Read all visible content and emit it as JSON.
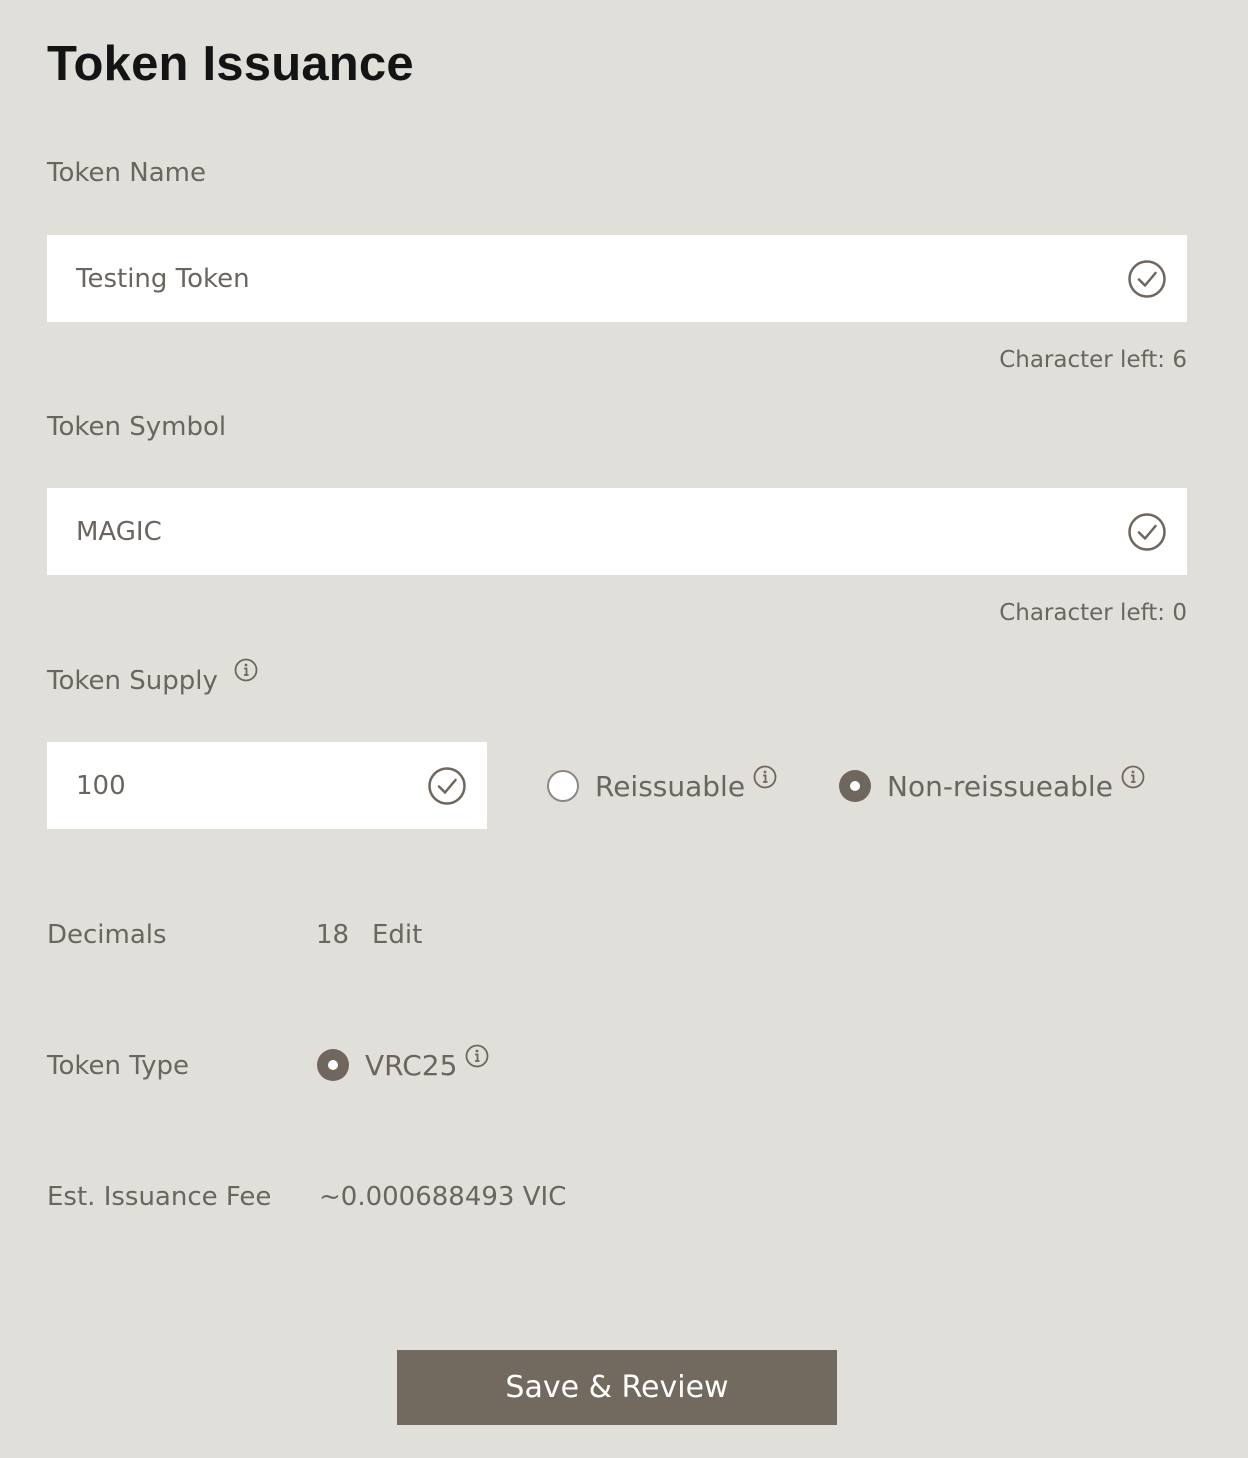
{
  "page": {
    "title": "Token Issuance"
  },
  "token_name": {
    "label": "Token Name",
    "value": "Testing Token",
    "char_left": "Character left: 6"
  },
  "token_symbol": {
    "label": "Token Symbol",
    "value": "MAGIC",
    "char_left": "Character left: 0"
  },
  "token_supply": {
    "label": "Token Supply",
    "value": "100",
    "options": [
      {
        "label": "Reissuable",
        "selected": false
      },
      {
        "label": "Non-reissueable",
        "selected": true
      }
    ]
  },
  "decimals": {
    "label": "Decimals",
    "value": "18",
    "edit_label": "Edit"
  },
  "token_type": {
    "label": "Token Type",
    "option_label": "VRC25",
    "selected": true
  },
  "fee": {
    "label": "Est. Issuance Fee",
    "value": "~0.000688493 VIC"
  },
  "actions": {
    "save_label": "Save & Review"
  },
  "colors": {
    "background": "#e0dfda",
    "accent": "#736a5f",
    "text": "#6b6560",
    "title": "#141414"
  },
  "icons": [
    "check-circle-icon",
    "info-icon"
  ]
}
